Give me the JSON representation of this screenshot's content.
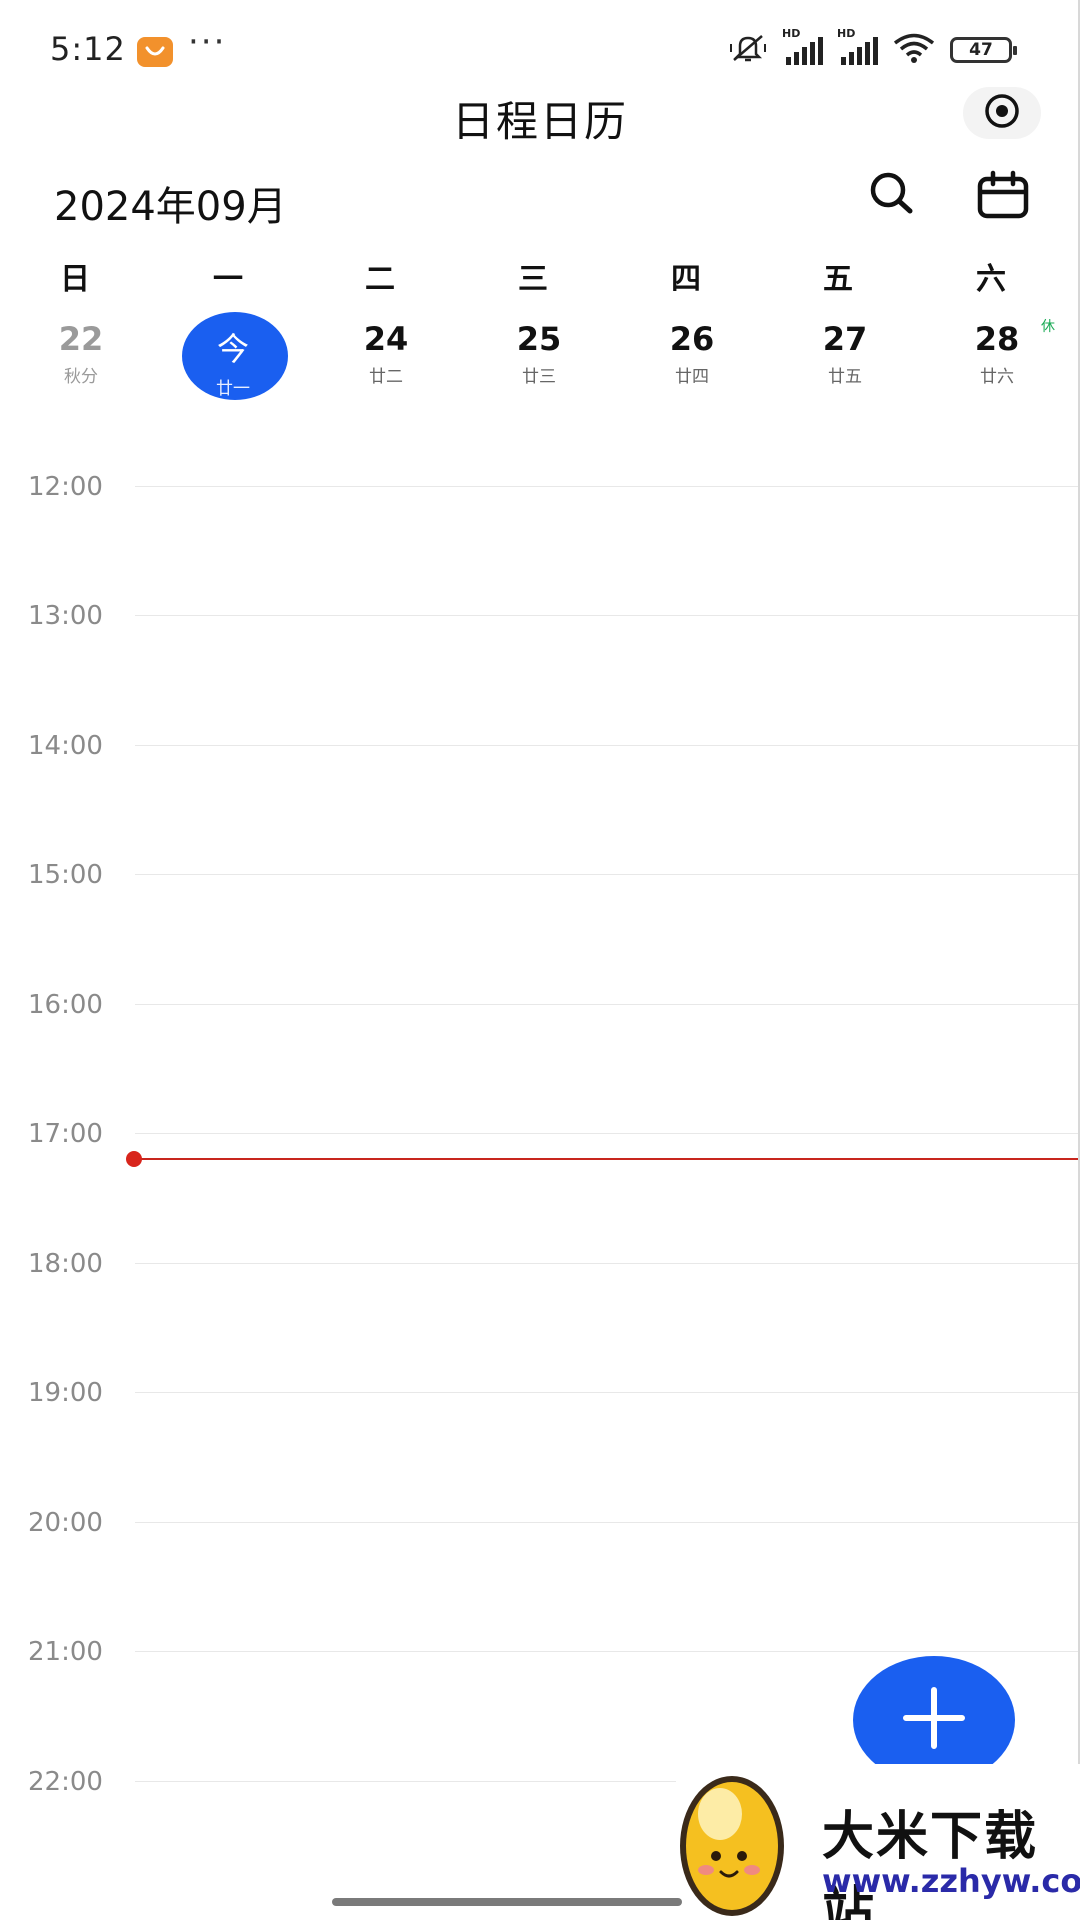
{
  "status_bar": {
    "time": "5:12",
    "more": "···",
    "signal1_label": "HD",
    "signal2_label": "HD",
    "battery": "47"
  },
  "header": {
    "title": "日程日历",
    "month": "2024年09月"
  },
  "week": {
    "weekdays": [
      "日",
      "一",
      "二",
      "三",
      "四",
      "五",
      "六"
    ],
    "days": [
      {
        "num": "22",
        "lunar": "秋分"
      },
      {
        "num": "今",
        "lunar": "廿一"
      },
      {
        "num": "24",
        "lunar": "廿二"
      },
      {
        "num": "25",
        "lunar": "廿三"
      },
      {
        "num": "26",
        "lunar": "廿四"
      },
      {
        "num": "27",
        "lunar": "廿五"
      },
      {
        "num": "28",
        "lunar": "廿六"
      }
    ],
    "holiday_tag": "休"
  },
  "timeline": {
    "hours": [
      "12:00",
      "13:00",
      "14:00",
      "15:00",
      "16:00",
      "17:00",
      "18:00",
      "19:00",
      "20:00",
      "21:00",
      "22:00"
    ]
  },
  "colors": {
    "accent": "#1a5ff0",
    "now_line": "#c8261e",
    "holiday": "#1aaa55"
  },
  "icons": [
    "eye-icon",
    "search-icon",
    "calendar-icon",
    "plus-icon",
    "wifi-icon",
    "mute-icon"
  ],
  "watermark": {
    "title": "大米下载站",
    "url": "www.zzhyw.com"
  }
}
